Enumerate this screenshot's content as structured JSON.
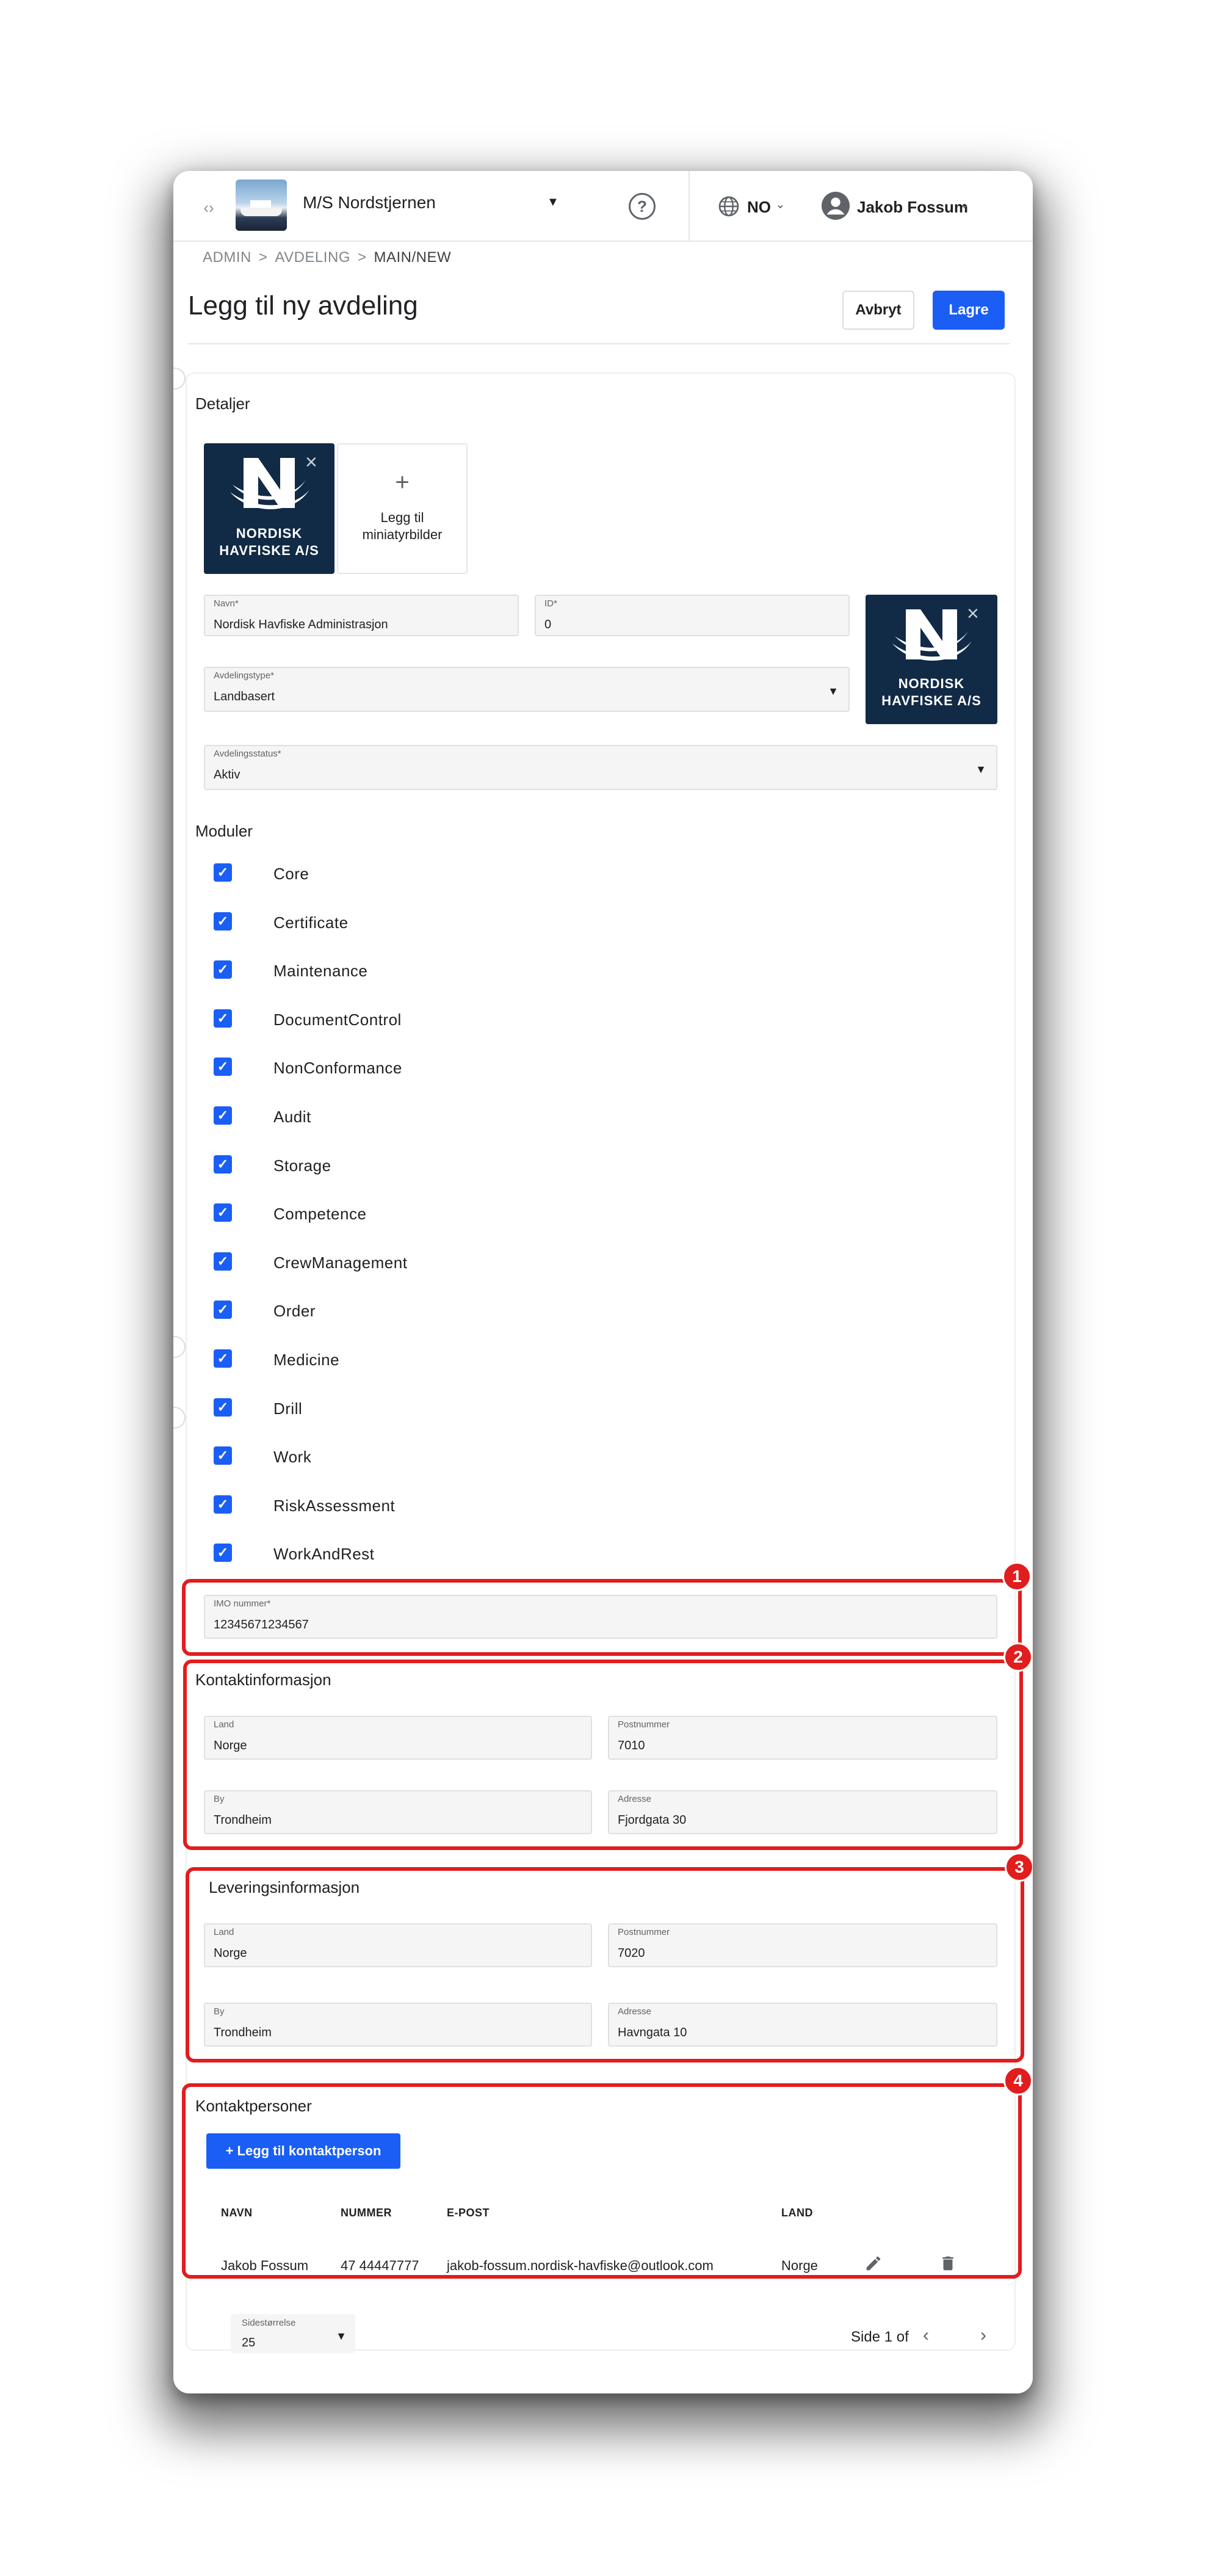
{
  "header": {
    "vessel_name": "M/S Nordstjernen",
    "language": "NO",
    "user_name": "Jakob Fossum"
  },
  "breadcrumb": [
    "ADMIN",
    "AVDELING",
    "MAIN/NEW"
  ],
  "page": {
    "title": "Legg til ny avdeling",
    "cancel_label": "Avbryt",
    "save_label": "Lagre"
  },
  "details": {
    "section_title": "Detaljer",
    "logo_text_line1": "NORDISK",
    "logo_text_line2": "HAVFISKE A/S",
    "add_thumbnail_label_line1": "Legg til",
    "add_thumbnail_label_line2": "miniatyrbilder",
    "name_label": "Navn*",
    "name_value": "Nordisk Havfiske Administrasjon",
    "id_label": "ID*",
    "id_value": "0",
    "type_label": "Avdelingstype*",
    "type_value": "Landbasert",
    "status_label": "Avdelingsstatus*",
    "status_value": "Aktiv"
  },
  "modules": {
    "section_title": "Moduler",
    "items": [
      "Core",
      "Certificate",
      "Maintenance",
      "DocumentControl",
      "NonConformance",
      "Audit",
      "Storage",
      "Competence",
      "CrewManagement",
      "Order",
      "Medicine",
      "Drill",
      "Work",
      "RiskAssessment",
      "WorkAndRest"
    ]
  },
  "imo": {
    "label": "IMO nummer*",
    "value": "12345671234567"
  },
  "contact_info": {
    "section_title": "Kontaktinformasjon",
    "country_label": "Land",
    "country_value": "Norge",
    "postal_label": "Postnummer",
    "postal_value": "7010",
    "city_label": "By",
    "city_value": "Trondheim",
    "address_label": "Adresse",
    "address_value": "Fjordgata 30"
  },
  "delivery_info": {
    "section_title": "Leveringsinformasjon",
    "country_label": "Land",
    "country_value": "Norge",
    "postal_label": "Postnummer",
    "postal_value": "7020",
    "city_label": "By",
    "city_value": "Trondheim",
    "address_label": "Adresse",
    "address_value": "Havngata 10"
  },
  "contacts": {
    "section_title": "Kontaktpersoner",
    "add_label": "+ Legg til kontaktperson",
    "columns": [
      "NAVN",
      "NUMMER",
      "E-POST",
      "LAND"
    ],
    "rows": [
      {
        "name": "Jakob Fossum",
        "number": "47 44447777",
        "email": "jakob-fossum.nordisk-havfiske@outlook.com",
        "country": "Norge"
      }
    ]
  },
  "pagination": {
    "page_size_label": "Sidestørrelse",
    "page_size_value": "25",
    "page_info": "Side 1 of"
  },
  "annotations": [
    "1",
    "2",
    "3",
    "4"
  ],
  "colors": {
    "primary": "#1a5ef5",
    "highlight": "#e11d1d",
    "logo_navy": "#112a46"
  }
}
